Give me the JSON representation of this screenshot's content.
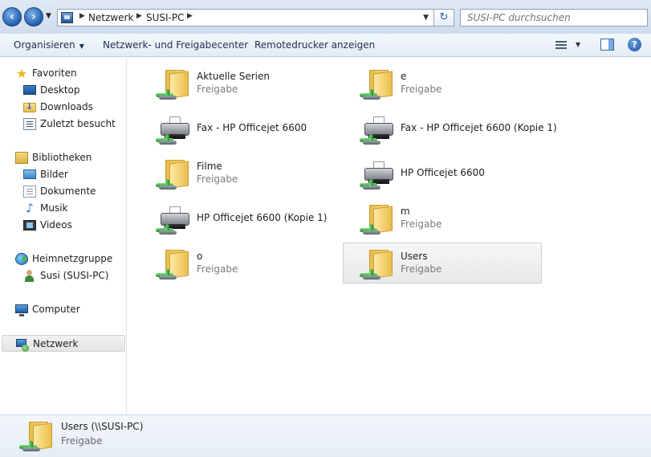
{
  "address_bar": {
    "crumbs": [
      "Netzwerk",
      "SUSI-PC"
    ],
    "search_placeholder": "SUSI-PC durchsuchen"
  },
  "toolbar": {
    "organize": "Organisieren",
    "network_center": "Netzwerk- und Freigabecenter",
    "remote_printers": "Remotedrucker anzeigen"
  },
  "sidebar": {
    "favorites": "Favoriten",
    "desktop": "Desktop",
    "downloads": "Downloads",
    "recent": "Zuletzt besucht",
    "libraries": "Bibliotheken",
    "pictures": "Bilder",
    "documents": "Dokumente",
    "music": "Musik",
    "videos": "Videos",
    "homegroup": "Heimnetzgruppe",
    "user": "Susi (SUSI-PC)",
    "computer": "Computer",
    "network": "Netzwerk"
  },
  "items": [
    {
      "name": "Aktuelle Serien",
      "sub": "Freigabe",
      "icon": "shared-folder-icon"
    },
    {
      "name": "e",
      "sub": "Freigabe",
      "icon": "shared-folder-icon"
    },
    {
      "name": "Fax - HP Officejet 6600",
      "sub": "",
      "icon": "printer-icon"
    },
    {
      "name": "Fax - HP Officejet 6600 (Kopie 1)",
      "sub": "",
      "icon": "printer-icon"
    },
    {
      "name": "Filme",
      "sub": "Freigabe",
      "icon": "shared-folder-icon"
    },
    {
      "name": "HP Officejet 6600",
      "sub": "",
      "icon": "printer-icon"
    },
    {
      "name": "HP Officejet 6600 (Kopie 1)",
      "sub": "",
      "icon": "printer-icon"
    },
    {
      "name": "m",
      "sub": "Freigabe",
      "icon": "shared-folder-icon"
    },
    {
      "name": "o",
      "sub": "Freigabe",
      "icon": "shared-folder-icon"
    },
    {
      "name": "Users",
      "sub": "Freigabe",
      "icon": "shared-folder-icon"
    }
  ],
  "details": {
    "name": "Users (\\\\SUSI-PC)",
    "type": "Freigabe"
  }
}
